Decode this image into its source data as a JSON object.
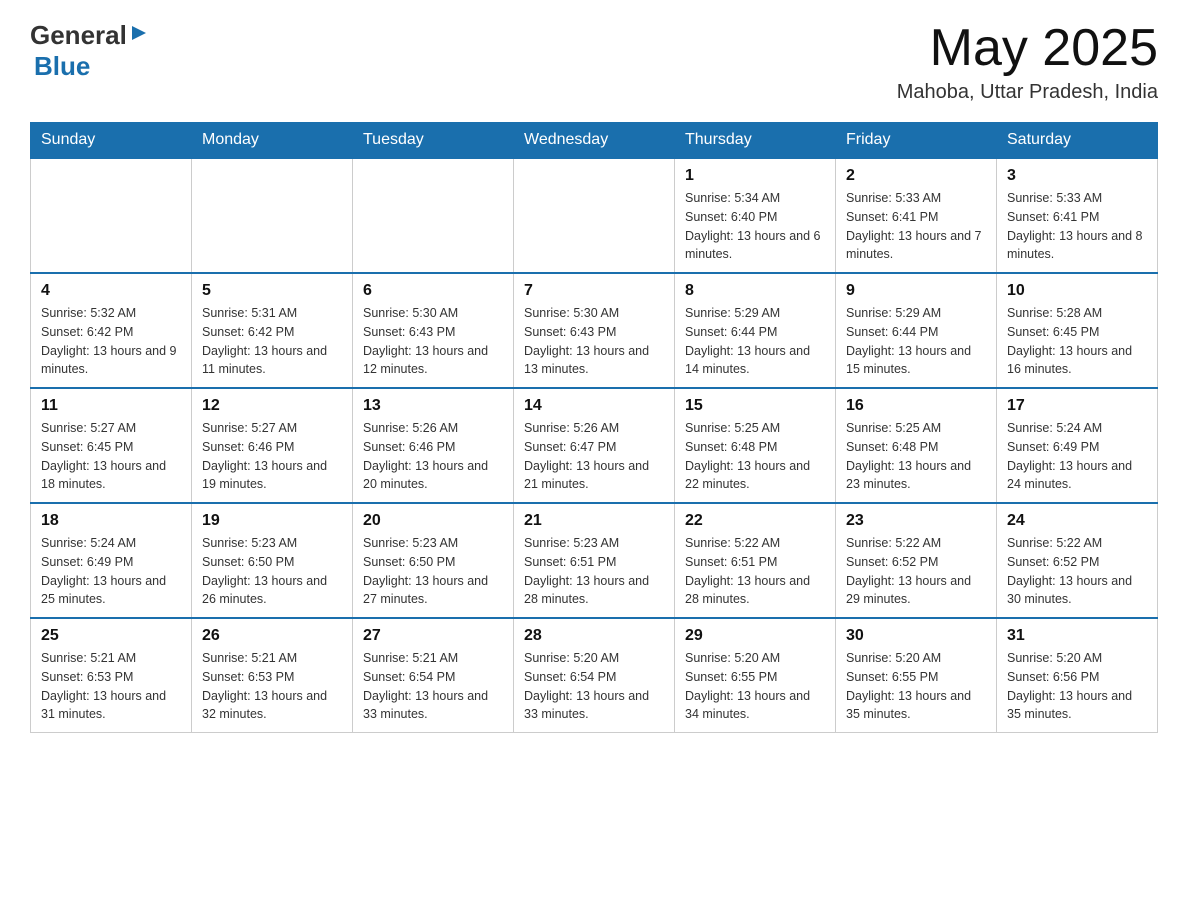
{
  "header": {
    "logo_general": "General",
    "logo_arrow": "▶",
    "logo_blue": "Blue",
    "month_title": "May 2025",
    "location": "Mahoba, Uttar Pradesh, India"
  },
  "weekdays": [
    "Sunday",
    "Monday",
    "Tuesday",
    "Wednesday",
    "Thursday",
    "Friday",
    "Saturday"
  ],
  "weeks": [
    [
      {
        "day": "",
        "sunrise": "",
        "sunset": "",
        "daylight": ""
      },
      {
        "day": "",
        "sunrise": "",
        "sunset": "",
        "daylight": ""
      },
      {
        "day": "",
        "sunrise": "",
        "sunset": "",
        "daylight": ""
      },
      {
        "day": "",
        "sunrise": "",
        "sunset": "",
        "daylight": ""
      },
      {
        "day": "1",
        "sunrise": "Sunrise: 5:34 AM",
        "sunset": "Sunset: 6:40 PM",
        "daylight": "Daylight: 13 hours and 6 minutes."
      },
      {
        "day": "2",
        "sunrise": "Sunrise: 5:33 AM",
        "sunset": "Sunset: 6:41 PM",
        "daylight": "Daylight: 13 hours and 7 minutes."
      },
      {
        "day": "3",
        "sunrise": "Sunrise: 5:33 AM",
        "sunset": "Sunset: 6:41 PM",
        "daylight": "Daylight: 13 hours and 8 minutes."
      }
    ],
    [
      {
        "day": "4",
        "sunrise": "Sunrise: 5:32 AM",
        "sunset": "Sunset: 6:42 PM",
        "daylight": "Daylight: 13 hours and 9 minutes."
      },
      {
        "day": "5",
        "sunrise": "Sunrise: 5:31 AM",
        "sunset": "Sunset: 6:42 PM",
        "daylight": "Daylight: 13 hours and 11 minutes."
      },
      {
        "day": "6",
        "sunrise": "Sunrise: 5:30 AM",
        "sunset": "Sunset: 6:43 PM",
        "daylight": "Daylight: 13 hours and 12 minutes."
      },
      {
        "day": "7",
        "sunrise": "Sunrise: 5:30 AM",
        "sunset": "Sunset: 6:43 PM",
        "daylight": "Daylight: 13 hours and 13 minutes."
      },
      {
        "day": "8",
        "sunrise": "Sunrise: 5:29 AM",
        "sunset": "Sunset: 6:44 PM",
        "daylight": "Daylight: 13 hours and 14 minutes."
      },
      {
        "day": "9",
        "sunrise": "Sunrise: 5:29 AM",
        "sunset": "Sunset: 6:44 PM",
        "daylight": "Daylight: 13 hours and 15 minutes."
      },
      {
        "day": "10",
        "sunrise": "Sunrise: 5:28 AM",
        "sunset": "Sunset: 6:45 PM",
        "daylight": "Daylight: 13 hours and 16 minutes."
      }
    ],
    [
      {
        "day": "11",
        "sunrise": "Sunrise: 5:27 AM",
        "sunset": "Sunset: 6:45 PM",
        "daylight": "Daylight: 13 hours and 18 minutes."
      },
      {
        "day": "12",
        "sunrise": "Sunrise: 5:27 AM",
        "sunset": "Sunset: 6:46 PM",
        "daylight": "Daylight: 13 hours and 19 minutes."
      },
      {
        "day": "13",
        "sunrise": "Sunrise: 5:26 AM",
        "sunset": "Sunset: 6:46 PM",
        "daylight": "Daylight: 13 hours and 20 minutes."
      },
      {
        "day": "14",
        "sunrise": "Sunrise: 5:26 AM",
        "sunset": "Sunset: 6:47 PM",
        "daylight": "Daylight: 13 hours and 21 minutes."
      },
      {
        "day": "15",
        "sunrise": "Sunrise: 5:25 AM",
        "sunset": "Sunset: 6:48 PM",
        "daylight": "Daylight: 13 hours and 22 minutes."
      },
      {
        "day": "16",
        "sunrise": "Sunrise: 5:25 AM",
        "sunset": "Sunset: 6:48 PM",
        "daylight": "Daylight: 13 hours and 23 minutes."
      },
      {
        "day": "17",
        "sunrise": "Sunrise: 5:24 AM",
        "sunset": "Sunset: 6:49 PM",
        "daylight": "Daylight: 13 hours and 24 minutes."
      }
    ],
    [
      {
        "day": "18",
        "sunrise": "Sunrise: 5:24 AM",
        "sunset": "Sunset: 6:49 PM",
        "daylight": "Daylight: 13 hours and 25 minutes."
      },
      {
        "day": "19",
        "sunrise": "Sunrise: 5:23 AM",
        "sunset": "Sunset: 6:50 PM",
        "daylight": "Daylight: 13 hours and 26 minutes."
      },
      {
        "day": "20",
        "sunrise": "Sunrise: 5:23 AM",
        "sunset": "Sunset: 6:50 PM",
        "daylight": "Daylight: 13 hours and 27 minutes."
      },
      {
        "day": "21",
        "sunrise": "Sunrise: 5:23 AM",
        "sunset": "Sunset: 6:51 PM",
        "daylight": "Daylight: 13 hours and 28 minutes."
      },
      {
        "day": "22",
        "sunrise": "Sunrise: 5:22 AM",
        "sunset": "Sunset: 6:51 PM",
        "daylight": "Daylight: 13 hours and 28 minutes."
      },
      {
        "day": "23",
        "sunrise": "Sunrise: 5:22 AM",
        "sunset": "Sunset: 6:52 PM",
        "daylight": "Daylight: 13 hours and 29 minutes."
      },
      {
        "day": "24",
        "sunrise": "Sunrise: 5:22 AM",
        "sunset": "Sunset: 6:52 PM",
        "daylight": "Daylight: 13 hours and 30 minutes."
      }
    ],
    [
      {
        "day": "25",
        "sunrise": "Sunrise: 5:21 AM",
        "sunset": "Sunset: 6:53 PM",
        "daylight": "Daylight: 13 hours and 31 minutes."
      },
      {
        "day": "26",
        "sunrise": "Sunrise: 5:21 AM",
        "sunset": "Sunset: 6:53 PM",
        "daylight": "Daylight: 13 hours and 32 minutes."
      },
      {
        "day": "27",
        "sunrise": "Sunrise: 5:21 AM",
        "sunset": "Sunset: 6:54 PM",
        "daylight": "Daylight: 13 hours and 33 minutes."
      },
      {
        "day": "28",
        "sunrise": "Sunrise: 5:20 AM",
        "sunset": "Sunset: 6:54 PM",
        "daylight": "Daylight: 13 hours and 33 minutes."
      },
      {
        "day": "29",
        "sunrise": "Sunrise: 5:20 AM",
        "sunset": "Sunset: 6:55 PM",
        "daylight": "Daylight: 13 hours and 34 minutes."
      },
      {
        "day": "30",
        "sunrise": "Sunrise: 5:20 AM",
        "sunset": "Sunset: 6:55 PM",
        "daylight": "Daylight: 13 hours and 35 minutes."
      },
      {
        "day": "31",
        "sunrise": "Sunrise: 5:20 AM",
        "sunset": "Sunset: 6:56 PM",
        "daylight": "Daylight: 13 hours and 35 minutes."
      }
    ]
  ]
}
